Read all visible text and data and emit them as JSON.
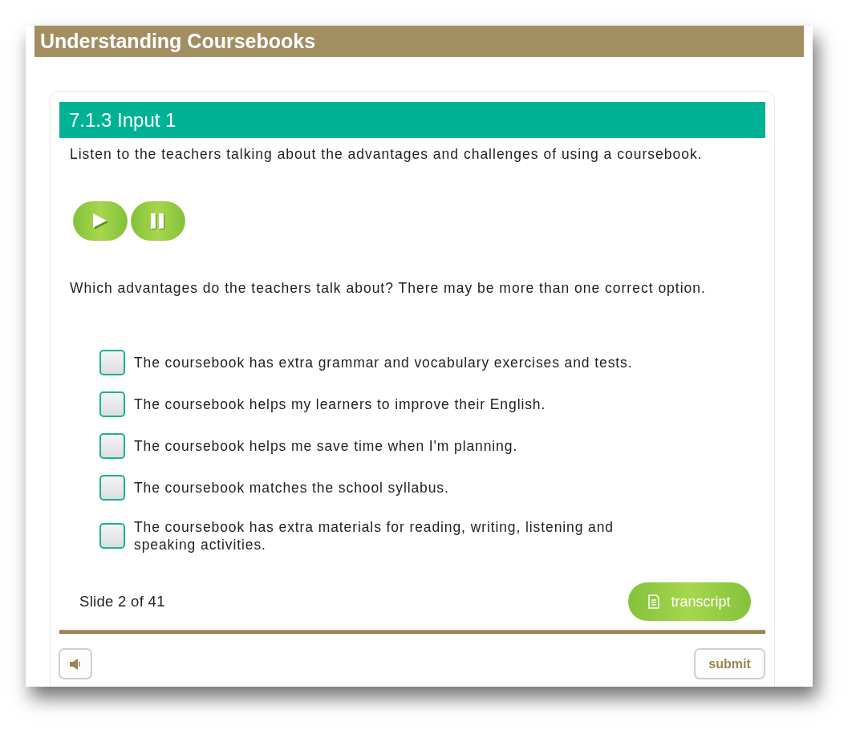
{
  "window": {
    "title": "Understanding Coursebooks"
  },
  "slide": {
    "heading": "7.1.3 Input 1",
    "instruction": "Listen to the teachers talking about the advantages and challenges of using a coursebook.",
    "audio_controls": [
      {
        "kind": "play"
      },
      {
        "kind": "pause"
      }
    ],
    "question": "Which advantages do the teachers talk about? There may be more than one correct option.",
    "options": [
      {
        "text": "The coursebook has extra grammar and vocabulary exercises and tests.",
        "checked": false
      },
      {
        "text": "The coursebook helps my learners to improve their English.",
        "checked": false
      },
      {
        "text": "The coursebook helps me save time when I'm planning.",
        "checked": false
      },
      {
        "text": "The coursebook matches the school syllabus.",
        "checked": false
      },
      {
        "text": "The coursebook has extra materials for reading, writing, listening and speaking activities.",
        "checked": false
      }
    ],
    "slide_counter": "Slide 2 of 41",
    "transcript_button": "transcript"
  },
  "footer": {
    "submit_button": "submit"
  }
}
